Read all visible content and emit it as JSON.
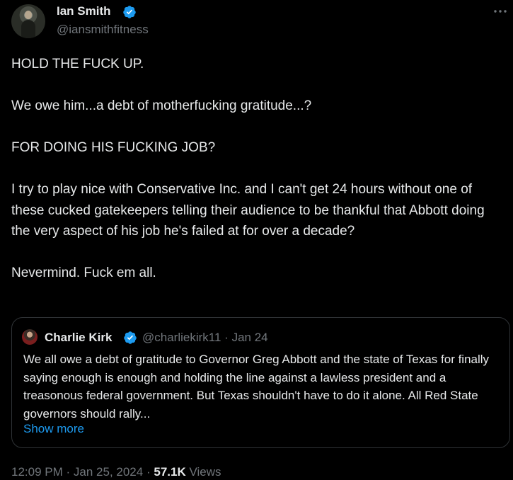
{
  "author": {
    "name": "Ian Smith",
    "handle": "@iansmithfitness",
    "verified": true
  },
  "tweet": {
    "paragraphs": [
      "HOLD THE FUCK UP.",
      "We owe him...a debt of motherfucking gratitude...?",
      "FOR DOING HIS FUCKING JOB?",
      "I try to play nice with Conservative Inc. and I can't get 24 hours without one of these cucked gatekeepers telling their audience to be thankful that Abbott doing the very aspect of his job he's failed at for over a decade?",
      "Nevermind. Fuck em all."
    ]
  },
  "quote": {
    "name": "Charlie Kirk",
    "handle": "@charliekirk11",
    "separator": "·",
    "date": "Jan 24",
    "text": "We all owe a debt of gratitude to Governor Greg Abbott and the state of Texas for finally saying enough is enough and holding the line against a lawless president and a treasonous federal government. But Texas shouldn't have to do it alone. All Red State governors should rally...",
    "show_more": "Show more"
  },
  "meta": {
    "time": "12:09 PM",
    "sep1": "·",
    "date": "Jan 25, 2024",
    "sep2": "·",
    "views_count": "57.1K",
    "views_label": "Views"
  },
  "colors": {
    "background": "#000000",
    "text_primary": "#e7e9ea",
    "text_secondary": "#71767b",
    "accent": "#1d9bf0",
    "border": "#2f3336"
  },
  "icons": {
    "verified": "verified-badge-icon",
    "more": "more-horizontal-icon"
  }
}
